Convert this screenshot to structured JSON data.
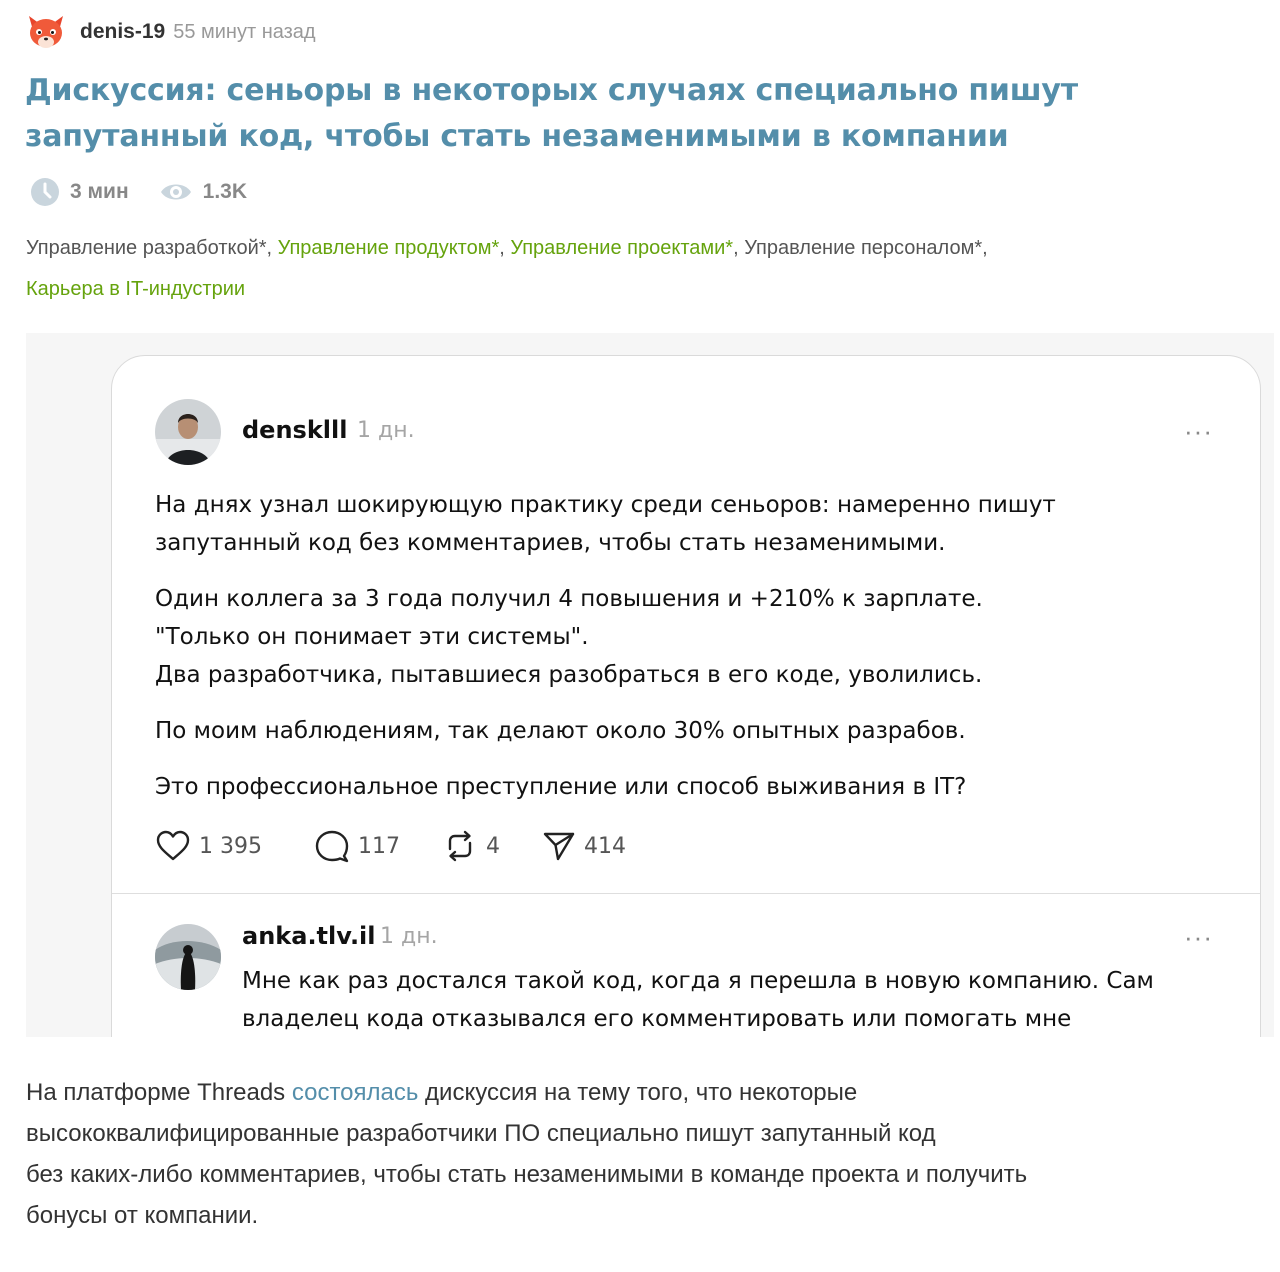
{
  "author": {
    "name": "denis-19",
    "time": "55 минут назад"
  },
  "title": "Дискуссия: сеньоры в некоторых случаях специально пишут запутанный код, чтобы стать незаменимыми в компании",
  "meta": {
    "read_time": "3 мин",
    "views": "1.3K"
  },
  "hubs": [
    {
      "label": "Управление разработкой*",
      "sep": ", "
    },
    {
      "label": "Управление продуктом*",
      "sep": ", "
    },
    {
      "label": "Управление проектами*",
      "sep": ", "
    },
    {
      "label": "Управление персоналом*",
      "sep": ","
    },
    {
      "label": "Карьера в IT-индустрии",
      "sep": ""
    }
  ],
  "colors": {
    "title": "#548eaa",
    "hub_highlight": "#65a30d",
    "link": "#548eaa"
  },
  "thread_post": {
    "user": "densklll",
    "time": "1 дн.",
    "more_icon": "···",
    "paragraphs": [
      [
        "На днях узнал шокирующую практику среди сеньоров: намеренно пишут",
        "запутанный код без комментариев, чтобы стать незаменимыми."
      ],
      [
        "Один коллега за 3 года получил 4 повышения и +210% к зарплате.",
        "\"Только он понимает эти системы\".",
        "Два разработчика, пытавшиеся разобраться в его коде, уволились."
      ],
      [
        "По моим наблюдениям, так делают около 30% опытных разрабов."
      ],
      [
        "Это профессиональное преступление или способ выживания в IT?"
      ]
    ],
    "stats": {
      "likes": "1 395",
      "replies": "117",
      "reposts": "4",
      "shares": "414"
    }
  },
  "thread_reply": {
    "user": "anka.tlv.il",
    "time": "1 дн.",
    "more_icon": "···",
    "lines": [
      "Мне как раз достался такой код, когда я перешла в новую компанию. Сам",
      "владелец кода отказывался его комментировать или помогать мне"
    ]
  },
  "lead": {
    "before": "На платформе Threads ",
    "link": "состоялась",
    "lines_after": [
      " дискуссия на тему того, что некоторые",
      "высококвалифицированные разработчики ПО специально пишут запутанный код",
      "без каких-либо комментариев, чтобы стать незаменимыми в команде проекта и получить",
      "бонусы от компании."
    ]
  }
}
